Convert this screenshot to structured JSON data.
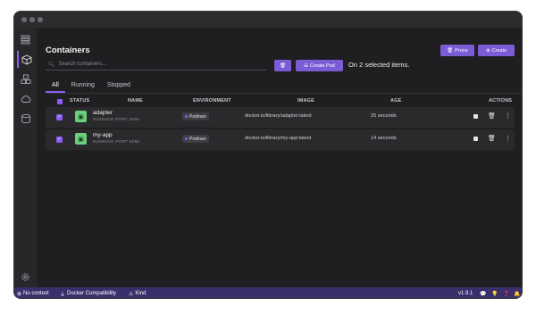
{
  "header": {
    "title": "Containers"
  },
  "buttons": {
    "prune": "Prune",
    "create": "Create",
    "create_pod": "Create Pod"
  },
  "search": {
    "placeholder": "Search containers..."
  },
  "selection": {
    "text": "On 2 selected items."
  },
  "tabs": [
    "All",
    "Running",
    "Stopped"
  ],
  "columns": {
    "status": "STATUS",
    "name": "NAME",
    "environment": "ENVIRONMENT",
    "image": "IMAGE",
    "age": "AGE",
    "actions": "ACTIONS"
  },
  "rows": [
    {
      "name": "adapter",
      "state": "RUNNING",
      "port": "PORT 5000",
      "environment": "Podman",
      "image": "docker.io/library/adapter:latest",
      "age": "25 seconds"
    },
    {
      "name": "my-app",
      "state": "RUNNING",
      "port": "PORT 8080",
      "environment": "Podman",
      "image": "docker.io/library/my-app:latest",
      "age": "14 seconds"
    }
  ],
  "statusbar": {
    "context": "No context",
    "compat": "Docker Compatibility",
    "kind": "Kind",
    "version": "v1.9.1"
  },
  "colors": {
    "accent": "#8b5cf6",
    "status_running": "#6ad07b",
    "statusbar": "#3a2f6b"
  }
}
